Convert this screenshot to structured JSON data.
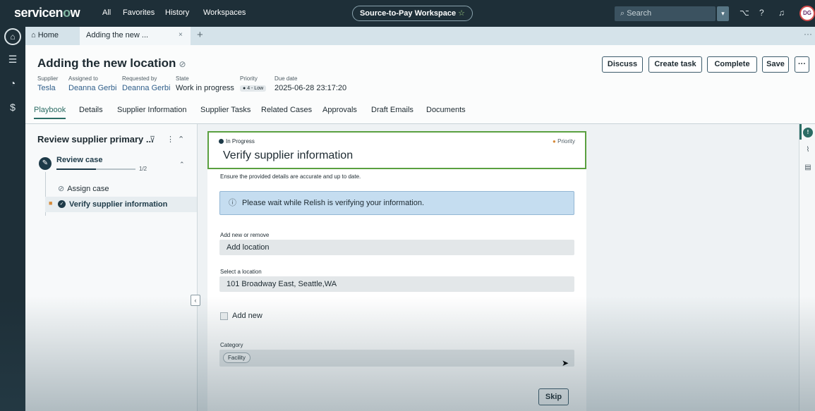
{
  "topnav": {
    "logo_prefix": "servicen",
    "logo_o": "o",
    "logo_suffix": "w",
    "links": [
      "All",
      "Favorites",
      "History",
      "Workspaces"
    ],
    "workspace": "Source-to-Pay Workspace",
    "workspace_star": "☆",
    "search_placeholder": "Search",
    "avatar_initials": "DG"
  },
  "tabs": {
    "home": "Home",
    "active": "Adding the new ...",
    "close": "×",
    "add": "+"
  },
  "record": {
    "title": "Adding the new location",
    "fields": [
      {
        "label": "Supplier",
        "value": "Tesla"
      },
      {
        "label": "Assigned to",
        "value": "Deanna Gerbi"
      },
      {
        "label": "Requested by",
        "value": "Deanna Gerbi"
      },
      {
        "label": "State",
        "value": "Work in progress"
      },
      {
        "label": "Priority",
        "value": "4 - Low"
      },
      {
        "label": "Due date",
        "value": "2025-06-28 23:17:20"
      }
    ],
    "actions": [
      "Discuss",
      "Create task",
      "Complete",
      "Save"
    ],
    "more": "···",
    "subtabs": [
      "Playbook",
      "Details",
      "Supplier Information",
      "Supplier Tasks",
      "Related Cases",
      "Approvals",
      "Draft Emails",
      "Documents"
    ]
  },
  "playbook": {
    "title": "Review supplier primary ...",
    "stage": "Review case",
    "progress_text": "1/2",
    "progress_fraction": 0.5,
    "activities": [
      "Assign case",
      "Verify supplier information"
    ]
  },
  "activity": {
    "status": "In Progress",
    "priority": "Priority",
    "title": "Verify supplier information",
    "description": "Ensure the provided details are accurate and up to date.",
    "info": "Please wait while Relish is verifying your information.",
    "field1_label": "Add new or remove",
    "field1_value": "Add location",
    "field2_label": "Select a location",
    "field2_value": "101 Broadway East, Seattle,WA",
    "checkbox_label": "Add new",
    "category_label": "Category",
    "category_value": "Facility",
    "skip_label": "Skip"
  },
  "colors": {
    "nav_bg": "#1e2f38",
    "accent": "#2b6c64",
    "card_border": "#5aa040",
    "info_bg": "#c5ddf0"
  }
}
